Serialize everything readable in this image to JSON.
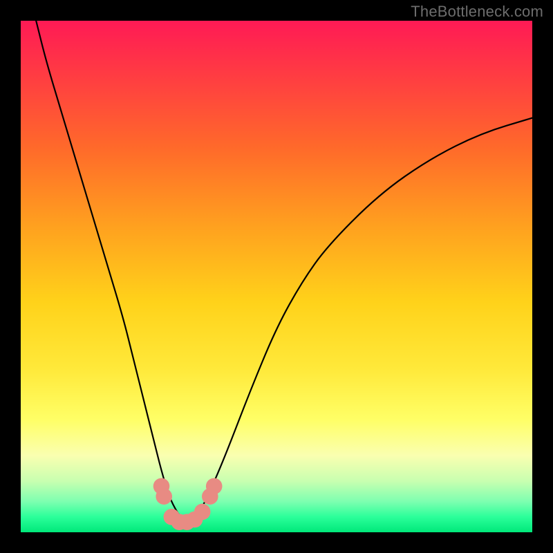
{
  "watermark": "TheBottleneck.com",
  "colors": {
    "curve_stroke": "#000000",
    "dot_fill": "#e88b83",
    "frame": "#000000"
  },
  "chart_data": {
    "type": "line",
    "title": "",
    "xlabel": "",
    "ylabel": "",
    "xlim": [
      0,
      100
    ],
    "ylim": [
      0,
      100
    ],
    "series": [
      {
        "name": "bottleneck-curve",
        "x": [
          3,
          5,
          8,
          11,
          14,
          17,
          20,
          22,
          24,
          26,
          27.5,
          29,
          30.5,
          32,
          33.5,
          35,
          37,
          40,
          45,
          50,
          55,
          60,
          70,
          80,
          90,
          100
        ],
        "y": [
          100,
          92,
          82,
          72,
          62,
          52,
          42,
          34,
          26,
          18,
          12,
          7,
          4,
          2,
          2,
          4,
          8,
          15,
          28,
          40,
          49,
          56,
          66,
          73,
          78,
          81
        ]
      }
    ],
    "markers": [
      {
        "x": 27.5,
        "y": 9,
        "r": 1.6
      },
      {
        "x": 28.0,
        "y": 7,
        "r": 1.6
      },
      {
        "x": 29.5,
        "y": 3,
        "r": 1.6
      },
      {
        "x": 31.0,
        "y": 2,
        "r": 1.6
      },
      {
        "x": 32.5,
        "y": 2,
        "r": 1.6
      },
      {
        "x": 34.0,
        "y": 2.5,
        "r": 1.6
      },
      {
        "x": 35.5,
        "y": 4,
        "r": 1.6
      },
      {
        "x": 37.0,
        "y": 7,
        "r": 1.6
      },
      {
        "x": 37.8,
        "y": 9,
        "r": 1.6
      }
    ]
  }
}
